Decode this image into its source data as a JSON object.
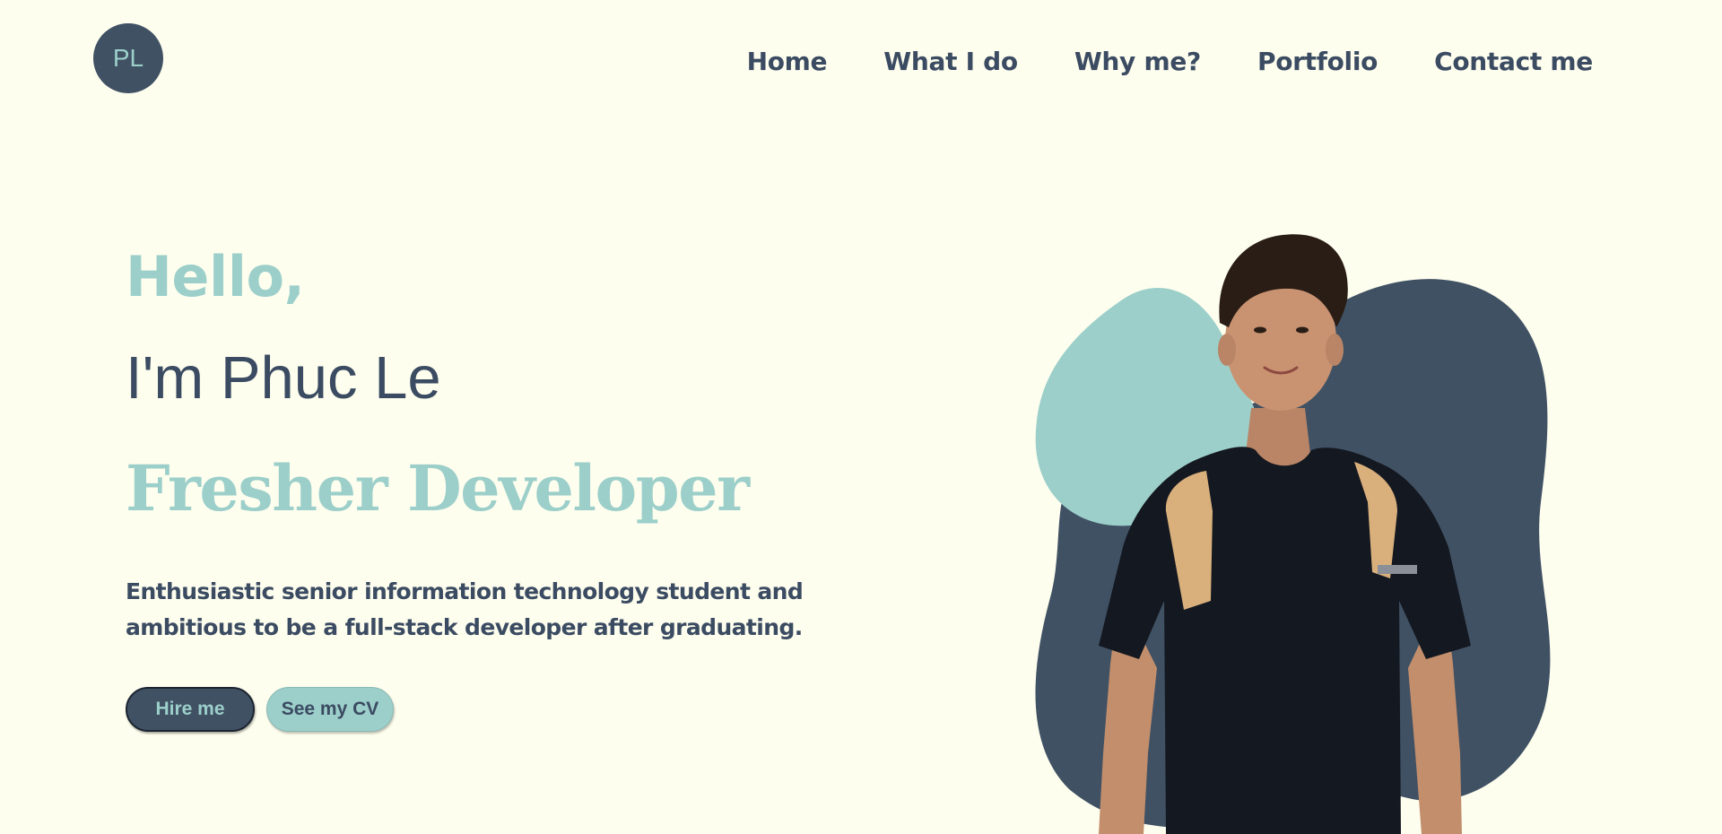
{
  "header": {
    "logo_text": "PL",
    "nav": [
      {
        "label": "Home"
      },
      {
        "label": "What I do"
      },
      {
        "label": "Why me?"
      },
      {
        "label": "Portfolio"
      },
      {
        "label": "Contact me"
      }
    ]
  },
  "hero": {
    "greeting": "Hello,",
    "name": "I'm Phuc Le",
    "role": "Fresher Developer",
    "description": "Enthusiastic senior information technology student and ambitious to be a full-stack developer after graduating.",
    "buttons": {
      "hire": "Hire me",
      "cv": "See my CV"
    }
  },
  "colors": {
    "background": "#fefeee",
    "primary_dark": "#405164",
    "accent_teal": "#9ccfca",
    "text_dark": "#3b4b62"
  },
  "illustration": {
    "description_icon": "portrait-photo"
  }
}
